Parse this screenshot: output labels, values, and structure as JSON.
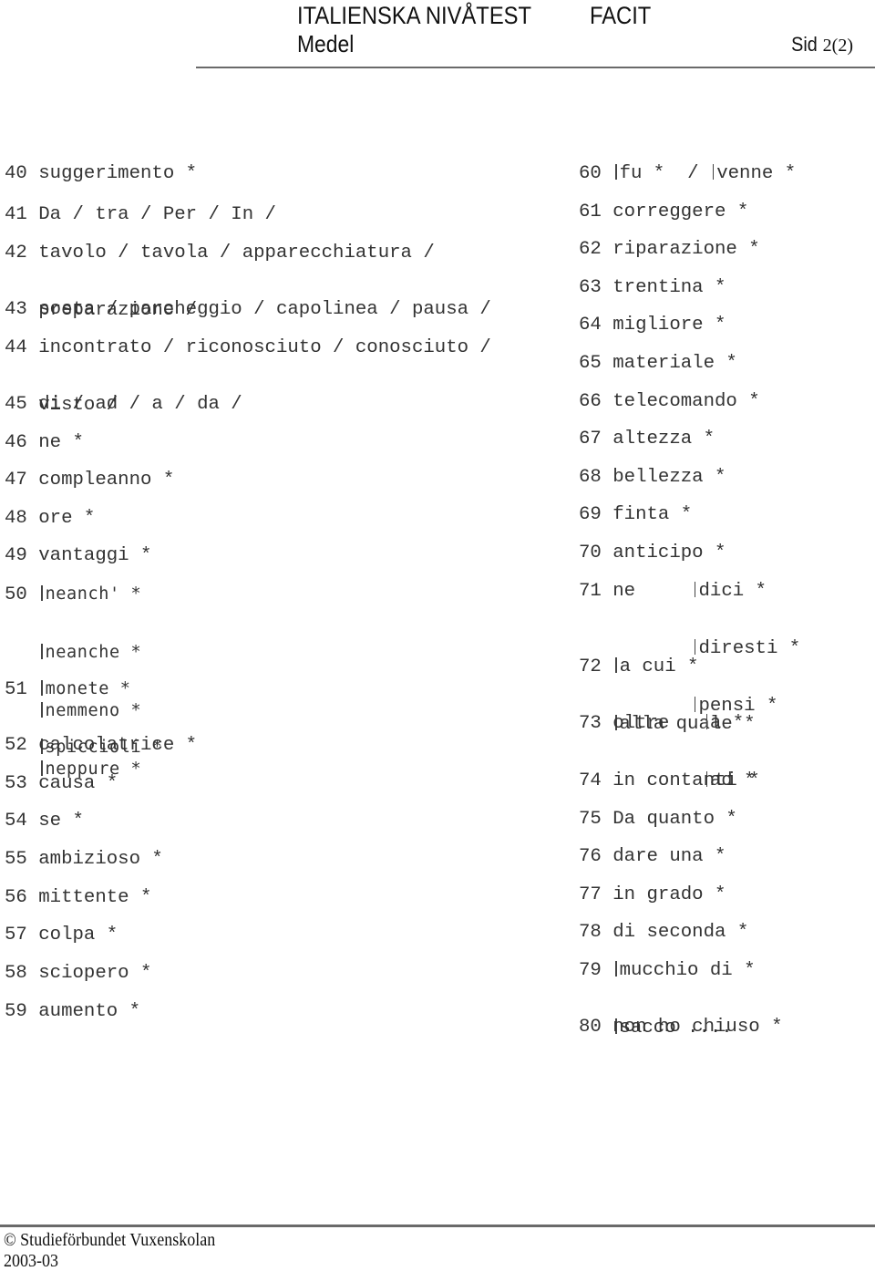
{
  "header": {
    "title": "ITALIENSKA NIVÅTEST",
    "subtitle_right": "FACIT",
    "level": "Medel",
    "page_label": "Sid",
    "page_number": "2(2)"
  },
  "answers_left": [
    {
      "num": "40",
      "lines": [
        [
          "suggerimento *"
        ]
      ]
    },
    {
      "num": "41",
      "lines": [
        [
          "Da / tra / Per / In /"
        ]
      ]
    },
    {
      "num": "42",
      "lines": [
        [
          "tavolo / tavola / apparecchiatura /"
        ],
        [
          "preparazione /"
        ]
      ]
    },
    {
      "num": "43",
      "lines": [
        [
          "sosta / parcheggio / capolinea / pausa /"
        ]
      ]
    },
    {
      "num": "44",
      "lines": [
        [
          "incontrato / riconosciuto / conosciuto /"
        ],
        [
          "visto /"
        ]
      ]
    },
    {
      "num": "45",
      "lines": [
        [
          "di / ad / a / da /"
        ]
      ]
    },
    {
      "num": "46",
      "lines": [
        [
          "ne *"
        ]
      ]
    },
    {
      "num": "47",
      "lines": [
        [
          "compleanno *"
        ]
      ]
    },
    {
      "num": "48",
      "lines": [
        [
          "ore *"
        ]
      ]
    },
    {
      "num": "49",
      "lines": [
        [
          "vantaggi *"
        ]
      ]
    },
    {
      "num": "50",
      "alternatives": [
        "neanch' *",
        "neanche *",
        "nemmeno *",
        "neppure *"
      ]
    },
    {
      "num": "51",
      "alternatives": [
        "monete *",
        "spiccioli *"
      ]
    },
    {
      "num": "52",
      "lines": [
        [
          "calcolatrice *"
        ]
      ]
    },
    {
      "num": "53",
      "lines": [
        [
          "causa *"
        ]
      ]
    },
    {
      "num": "54",
      "lines": [
        [
          "se *"
        ]
      ]
    },
    {
      "num": "55",
      "lines": [
        [
          "ambizioso *"
        ]
      ]
    },
    {
      "num": "56",
      "lines": [
        [
          "mittente *"
        ]
      ]
    },
    {
      "num": "57",
      "lines": [
        [
          "colpa *"
        ]
      ]
    },
    {
      "num": "58",
      "lines": [
        [
          "sciopero *"
        ]
      ]
    },
    {
      "num": "59",
      "lines": [
        [
          "aumento *"
        ]
      ]
    }
  ],
  "answers_right": [
    {
      "num": "60",
      "alt_a": "fu *",
      "separator": "/",
      "alt_b": "venne *"
    },
    {
      "num": "61",
      "text": "correggere *"
    },
    {
      "num": "62",
      "text": "riparazione *"
    },
    {
      "num": "63",
      "text": "trentina *"
    },
    {
      "num": "64",
      "text": "migliore *"
    },
    {
      "num": "65",
      "text": "materiale *"
    },
    {
      "num": "66",
      "text": "telecomando *"
    },
    {
      "num": "67",
      "text": "altezza *"
    },
    {
      "num": "68",
      "text": "bellezza *"
    },
    {
      "num": "69",
      "text": "finta *"
    },
    {
      "num": "70",
      "text": "anticipo *"
    },
    {
      "num": "71",
      "prefix": "ne",
      "alternatives": [
        "dici *",
        "diresti *",
        "pensi *"
      ]
    },
    {
      "num": "72",
      "alternatives": [
        "a cui *",
        "alla quale *"
      ]
    },
    {
      "num": "73",
      "prefix": "oltre",
      "alternatives": [
        "a *",
        "ad *"
      ]
    },
    {
      "num": "74",
      "text": "in contanti *"
    },
    {
      "num": "75",
      "text": "Da quanto *"
    },
    {
      "num": "76",
      "text": "dare una *"
    },
    {
      "num": "77",
      "text": "in grado *"
    },
    {
      "num": "78",
      "text": "di seconda *"
    },
    {
      "num": "79",
      "alternatives": [
        "mucchio di *",
        "sacco ...."
      ]
    },
    {
      "num": "80",
      "text": "non ho chiuso *"
    }
  ],
  "footer": {
    "copyright": "© Studieförbundet Vuxenskolan",
    "date": "2003-03"
  }
}
